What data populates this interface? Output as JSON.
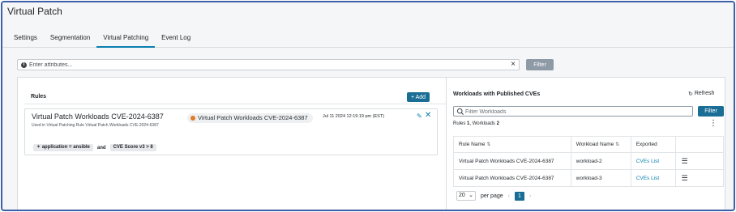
{
  "app": {
    "title": "Virtual Patch"
  },
  "tabs": [
    {
      "label": "Settings"
    },
    {
      "label": "Segmentation"
    },
    {
      "label": "Virtual Patching",
      "active": true
    },
    {
      "label": "Event Log"
    }
  ],
  "filterbar": {
    "placeholder": "Enter attributes...",
    "button_label": "Filter"
  },
  "rules": {
    "title": "Rules",
    "add_label": "+ Add",
    "items": [
      {
        "name": "Virtual Patch Workloads CVE-2024-6387",
        "description": "Used in Virtual Patching Rule Virtual Patch Workloads CVE-2024-6387",
        "chip_label": "Virtual Patch Workloads CVE-2024-6387",
        "date": "Jul 11 2024 12:19:19 pm (EST)",
        "conditions": {
          "tag1": "✶ application = ansible",
          "operator": "and",
          "tag2": "CVE Score v3 > 8"
        }
      }
    ]
  },
  "workloads": {
    "title": "Workloads with Published CVEs",
    "refresh_label": "Refresh",
    "search_placeholder": "Filter Workloads",
    "filter_label": "Filter",
    "summary": {
      "rules_label": "Rules",
      "rules_count": "1",
      "workloads_label": "Workloads",
      "workloads_count": "2"
    },
    "columns": [
      "Rule Name",
      "Workload Name",
      "Exported",
      ""
    ],
    "rows": [
      {
        "rule": "Virtual Patch Workloads CVE-2024-6387",
        "workload": "workload-2",
        "exported": "CVEs List"
      },
      {
        "rule": "Virtual Patch Workloads CVE-2024-6387",
        "workload": "workload-3",
        "exported": "CVEs List"
      }
    ],
    "pagination": {
      "per_page": "20",
      "per_page_label": "per page",
      "current_page": "1"
    }
  },
  "colors": {
    "accent": "#1a6e96",
    "link": "#0a7fb0",
    "tab_underline": "#0a7fb0",
    "frame_border": "#3b5fa8"
  }
}
